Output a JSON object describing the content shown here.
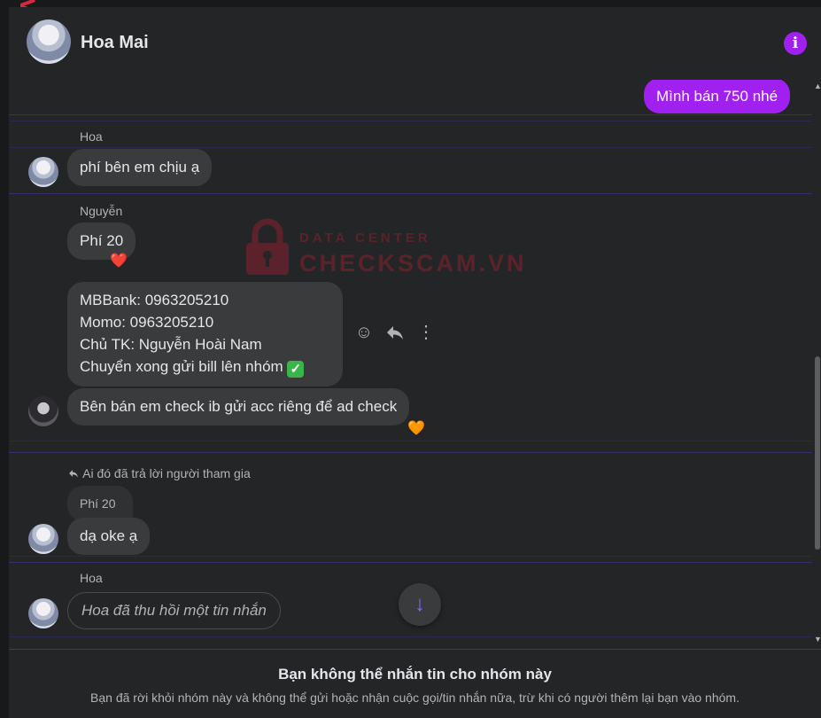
{
  "header": {
    "title": "Hoa Mai"
  },
  "messages": {
    "mine_1": "Mình bán 750 nhé",
    "sender_hoa_1": "Hoa",
    "msg_hoa_1": "phí bên em chịu ạ",
    "sender_nguyen": "Nguyễn",
    "msg_nguyen_1": "Phí 20",
    "reaction_1": "❤️",
    "msg_nguyen_2_lines": [
      "MBBank: 0963205210",
      "Momo: 0963205210",
      "Chủ TK: Nguyễn Hoài Nam",
      "Chuyển xong gửi bill lên nhóm"
    ],
    "msg_seller": "Bên bán em check ib gửi acc riêng để ad check",
    "reaction_2": "🧡",
    "reply_note": "Ai đó đã trả lời người tham gia",
    "reply_quote": "Phí 20",
    "msg_reply": "dạ oke ạ",
    "sender_hoa_2": "Hoa",
    "recalled": "Hoa đã thu hồi một tin nhắn"
  },
  "watermark": {
    "line1": "DATA CENTER",
    "line2": "CHECKSCAM.VN"
  },
  "footer": {
    "title": "Bạn không thể nhắn tin cho nhóm này",
    "subtitle": "Bạn đã rời khỏi nhóm này và không thể gửi hoặc nhận cuộc gọi/tin nhắn nữa, trừ khi có người thêm lại bạn vào nhóm."
  },
  "colors": {
    "accent": "#a020f0",
    "background": "#242526",
    "bubble": "#3a3b3c"
  },
  "icons": [
    "info-icon",
    "emoji-icon",
    "reply-icon",
    "more-icon",
    "arrow-down-icon",
    "check-mark-icon"
  ]
}
